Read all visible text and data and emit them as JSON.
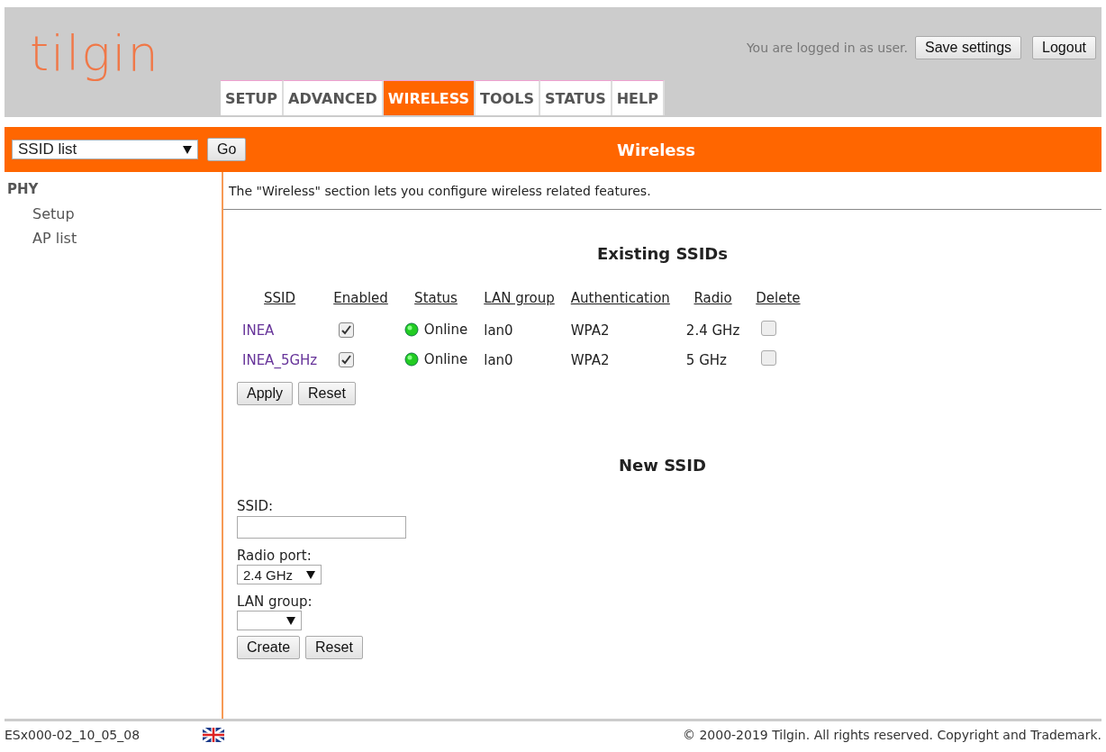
{
  "logo": "tilgin",
  "header": {
    "login_text": "You are logged in as user.",
    "buttons": [
      "Save settings",
      "Logout"
    ]
  },
  "tabs": [
    {
      "label": "SETUP",
      "selected": false
    },
    {
      "label": "ADVANCED",
      "selected": false
    },
    {
      "label": "WIRELESS",
      "selected": true
    },
    {
      "label": "TOOLS",
      "selected": false
    },
    {
      "label": "STATUS",
      "selected": false
    },
    {
      "label": "HELP",
      "selected": false
    }
  ],
  "nav": {
    "select": "SSID list",
    "go": "Go",
    "title": "Wireless"
  },
  "sidebar": {
    "heading": "PHY",
    "items": [
      {
        "label": "Setup"
      },
      {
        "label": "AP list"
      }
    ]
  },
  "intro": "The \"Wireless\" section lets you configure wireless related features.",
  "existing": {
    "title": "Existing SSIDs",
    "columns": [
      "SSID",
      "Enabled",
      "Status",
      "LAN group",
      "Authentication",
      "Radio",
      "Delete"
    ],
    "rows": [
      {
        "ssid": "INEA",
        "enabled": true,
        "status": "Online",
        "lan_group": "lan0",
        "auth": "WPA2",
        "radio": "2.4 GHz",
        "delete": false
      },
      {
        "ssid": "INEA_5GHz",
        "enabled": true,
        "status": "Online",
        "lan_group": "lan0",
        "auth": "WPA2",
        "radio": "5 GHz",
        "delete": false
      }
    ],
    "buttons": [
      "Apply",
      "Reset"
    ]
  },
  "new": {
    "title": "New SSID",
    "ssid_label": "SSID:",
    "radio_label": "Radio port:",
    "radio_value": "2.4 GHz",
    "lan_label": "LAN group:",
    "buttons": [
      "Create",
      "Reset"
    ]
  },
  "footer": {
    "version": "ESx000-02_10_05_08",
    "copyright": "© 2000-2019 Tilgin. All rights reserved. Copyright and Trademark."
  }
}
